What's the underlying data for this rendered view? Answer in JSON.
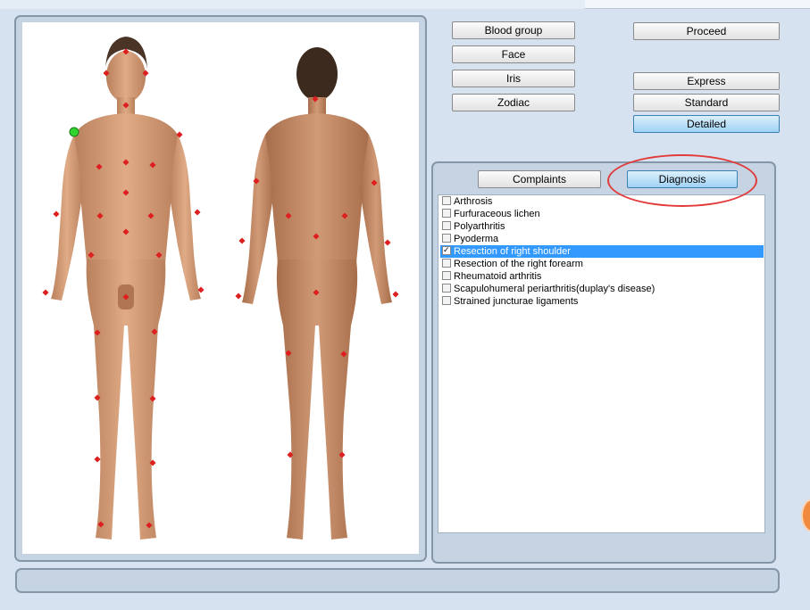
{
  "colors": {
    "marker": "#dd1f1f",
    "selected_marker": "#2fd42f",
    "annotation": "#e23b3b",
    "selection_bg": "#3399ff",
    "skin": "#d8a27a"
  },
  "selector_buttons": [
    "Blood group",
    "Face",
    "Iris",
    "Zodiac"
  ],
  "actions": {
    "proceed": "Proceed"
  },
  "modes": [
    "Express",
    "Standard",
    "Detailed"
  ],
  "active_mode": "Detailed",
  "tabs": {
    "complaints": "Complaints",
    "diagnosis": "Diagnosis",
    "active": "Diagnosis"
  },
  "diagnoses": [
    {
      "label": "Arthrosis",
      "checked": false,
      "selected": false
    },
    {
      "label": "Furfuraceous lichen",
      "checked": false,
      "selected": false
    },
    {
      "label": "Polyarthritis",
      "checked": false,
      "selected": false
    },
    {
      "label": "Pyoderma",
      "checked": false,
      "selected": false
    },
    {
      "label": "Resection of right shoulder",
      "checked": true,
      "selected": true
    },
    {
      "label": "Resection of the right forearm",
      "checked": false,
      "selected": false
    },
    {
      "label": "Rheumatoid arthritis",
      "checked": false,
      "selected": false
    },
    {
      "label": "Scapulohumeral periarthritis(duplay's disease)",
      "checked": false,
      "selected": false
    },
    {
      "label": "Strained juncturae ligaments",
      "checked": false,
      "selected": false
    }
  ],
  "status_text": ""
}
